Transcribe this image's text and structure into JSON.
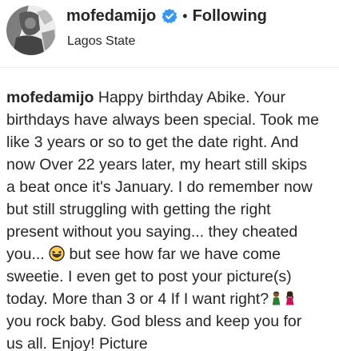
{
  "post": {
    "username": "mofedamijo",
    "separator": "•",
    "follow_status": "Following",
    "location": "Lagos State"
  },
  "caption": {
    "username": "mofedamijo",
    "lines": [
      "Happy birthday Abike. Your",
      "birthdays have always been special. Took me",
      "like 3 years or so to get the date right. And",
      "now Over 22 years later, my heart still skips",
      "a beat once it's January. I do remember now",
      "but still struggling with getting the right",
      "present without you saying... they cheated",
      "you...",
      "but see how far we have come",
      "sweetie. I even get to post your picture(s)",
      "today. More than 3 or 4 If I want right?",
      "you rock baby. God bless and keep you for",
      "us all. Enjoy! Picture"
    ]
  },
  "icons": {
    "verified": "verified-badge-icon",
    "laugh_emoji": "grinning-squinting-face-emoji",
    "couple_emoji": "woman-and-man-emoji"
  },
  "colors": {
    "text": "#262626",
    "verified_blue": "#3897f0",
    "divider": "#efefef"
  }
}
